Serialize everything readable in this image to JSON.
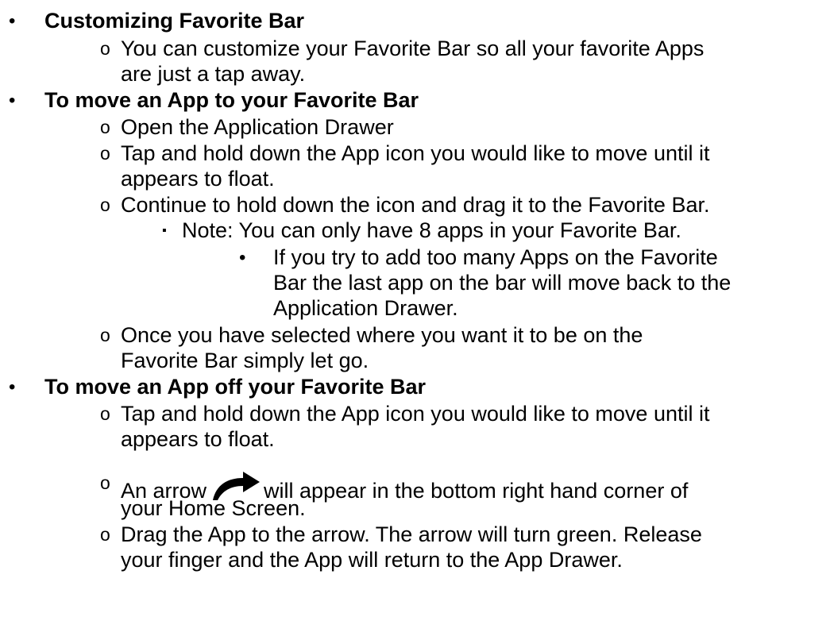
{
  "section1": {
    "heading": "Customizing Favorite Bar",
    "item1_line1": "You can customize your Favorite Bar so all your favorite Apps",
    "item1_line2": "are just a tap away."
  },
  "section2": {
    "heading": "To move an App to your Favorite Bar",
    "item1": "Open the Application Drawer",
    "item2_line1": "Tap and hold down the App icon you would like to move until it",
    "item2_line2": "appears to float.",
    "item3": "Continue to hold down the icon and drag it to the Favorite Bar.",
    "note": "Note: You can only have 8 apps in your Favorite Bar.",
    "subnote_line1": "If you try to add too many Apps on the Favorite",
    "subnote_line2": "Bar the last app on the bar will move back to the",
    "subnote_line3": "Application Drawer.",
    "item4_line1": "Once you have selected where you want it to be on the",
    "item4_line2": "Favorite Bar simply let go."
  },
  "section3": {
    "heading": "To move an App off your Favorite Bar",
    "item1_line1": "Tap and hold down the App icon you would like to move until it",
    "item1_line2": "appears to float.",
    "item2_before": "An arrow",
    "item2_after": "will appear in the bottom right hand corner of",
    "item2_line2": "your Home Screen.",
    "item3_line1": "Drag the App to the arrow. The arrow will turn green. Release",
    "item3_line2": "your finger and the App will return to the App Drawer."
  },
  "bullets": {
    "level1": "•",
    "level2": "o",
    "level3": "▪",
    "level4": "•"
  },
  "icons": {
    "arrow": "curved-arrow-icon"
  }
}
